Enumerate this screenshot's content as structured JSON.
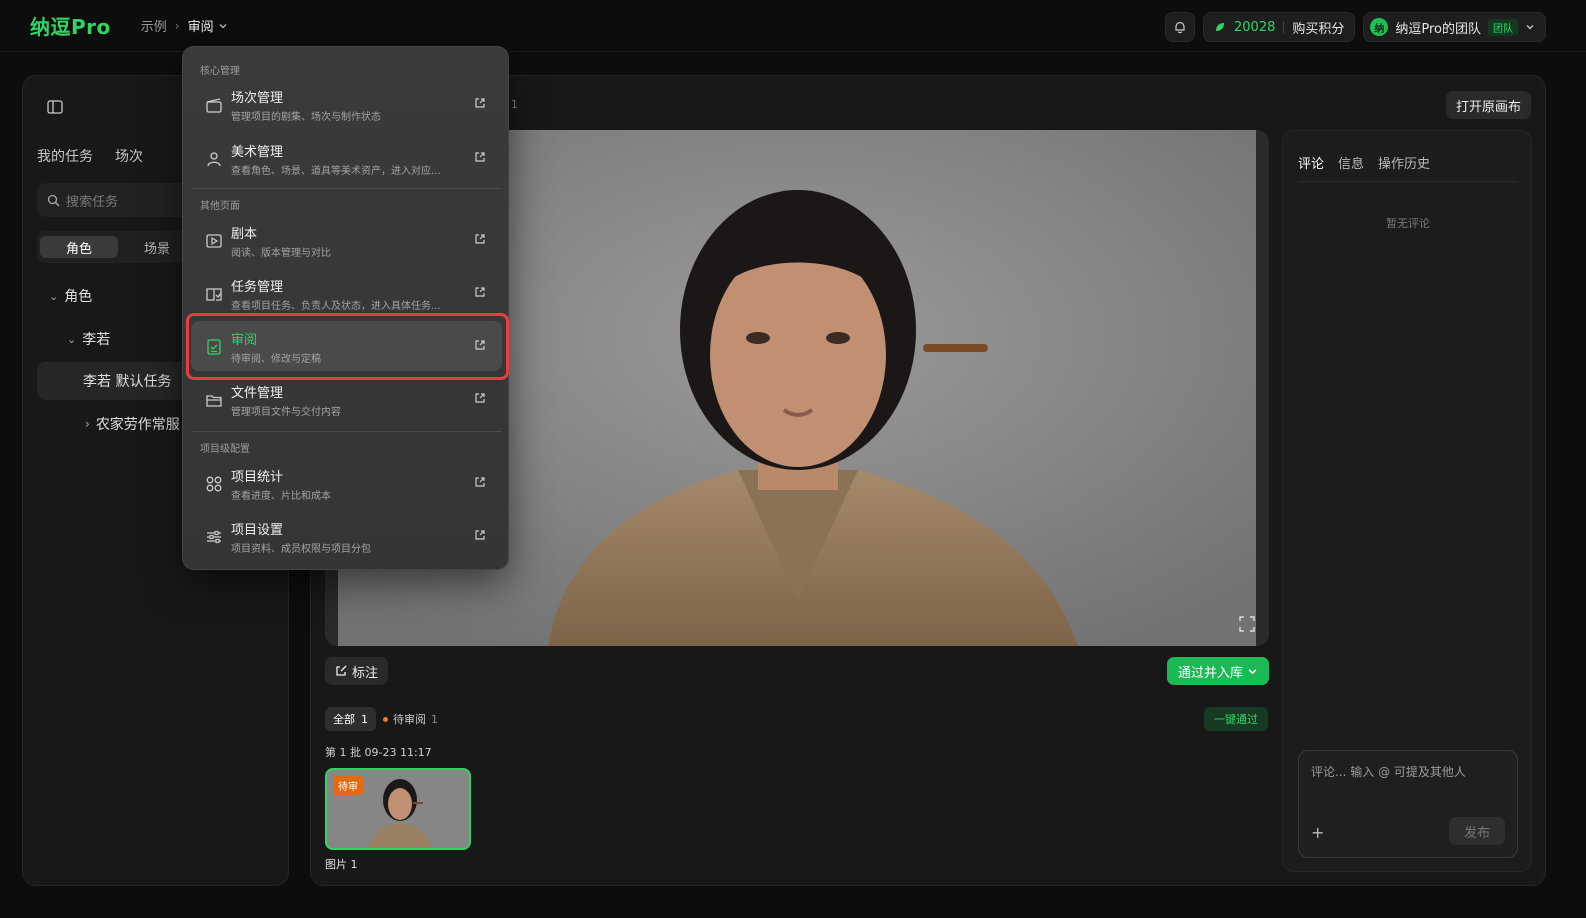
{
  "app": {
    "logo": "纳逗Pro"
  },
  "breadcrumb": {
    "root": "示例",
    "current": "审阅"
  },
  "topbar": {
    "points": "20028",
    "buy_label": "购买积分",
    "team_avatar": "纳",
    "team_name": "纳逗Pro的团队",
    "team_tag": "团队"
  },
  "left": {
    "tabs": [
      "我的任务",
      "场次"
    ],
    "search_placeholder": "搜索任务",
    "segments": [
      "角色",
      "场景"
    ],
    "tree": {
      "group": "角色",
      "person": "李若",
      "selected_task": "李若 默认任务",
      "child": "农家劳作常服"
    }
  },
  "main": {
    "header_count": "1",
    "open_canvas": "打开原画布",
    "mark_label": "标注",
    "approve_label": "通过并入库",
    "filters": {
      "all_label": "全部",
      "all_count": "1",
      "pending_label": "待审阅",
      "pending_count": "1"
    },
    "one_click": "一键通过",
    "batch_label": "第 1 批 09-23 11:17",
    "thumb_badge": "待审",
    "thumb_label": "图片 1"
  },
  "comments": {
    "tabs": [
      "评论",
      "信息",
      "操作历史"
    ],
    "empty": "暂无评论",
    "placeholder": "评论... 输入 @ 可提及其他人",
    "post": "发布"
  },
  "menu": {
    "sections": [
      "核心管理",
      "其他页面",
      "项目级配置"
    ],
    "items": [
      {
        "title": "场次管理",
        "desc": "管理项目的剧集、场次与制作状态",
        "icon": "clapper-icon"
      },
      {
        "title": "美术管理",
        "desc": "查看角色、场景、道具等美术资产，进入对应...",
        "icon": "user-icon"
      },
      {
        "title": "剧本",
        "desc": "阅读、版本管理与对比",
        "icon": "script-icon"
      },
      {
        "title": "任务管理",
        "desc": "查看项目任务、负责人及状态，进入具体任务...",
        "icon": "task-icon"
      },
      {
        "title": "审阅",
        "desc": "待审阅、修改与定稿",
        "icon": "review-icon"
      },
      {
        "title": "文件管理",
        "desc": "管理项目文件与交付内容",
        "icon": "folder-icon"
      },
      {
        "title": "项目统计",
        "desc": "查看进度、片比和成本",
        "icon": "stats-icon"
      },
      {
        "title": "项目设置",
        "desc": "项目资料、成员权限与项目分包",
        "icon": "settings-icon"
      }
    ]
  },
  "colors": {
    "accent": "#2fd564",
    "highlight": "#e53e3e",
    "pending": "#e36a12"
  }
}
